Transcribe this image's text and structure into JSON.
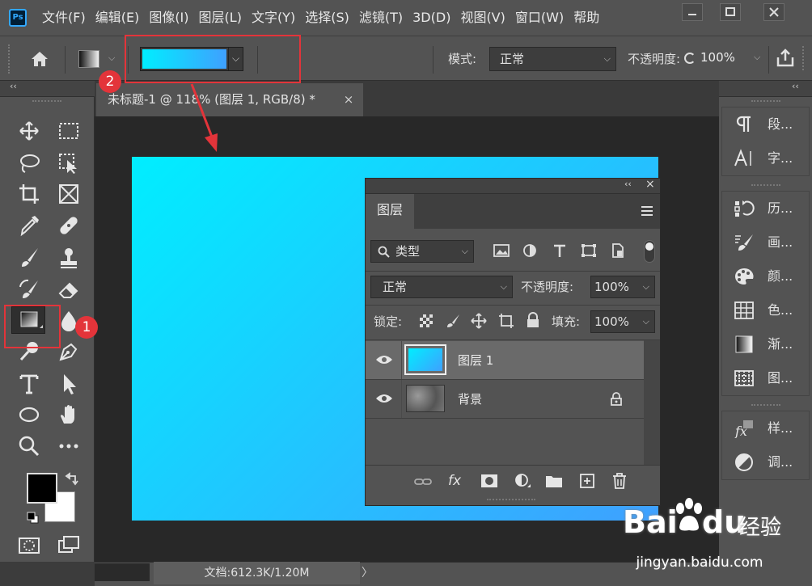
{
  "app": {
    "logo_text": "Ps",
    "menu": [
      "文件(F)",
      "编辑(E)",
      "图像(I)",
      "图层(L)",
      "文字(Y)",
      "选择(S)",
      "滤镜(T)",
      "3D(D)",
      "视图(V)",
      "窗口(W)",
      "帮助"
    ]
  },
  "options_bar": {
    "gradient_start": "#00eeff",
    "gradient_end": "#3fa0ff",
    "mode_label": "模式:",
    "mode_value": "正常",
    "opacity_label": "不透明度:",
    "opacity_value": "100%"
  },
  "document": {
    "tab_title": "未标题-1 @ 118% (图层 1, RGB/8) *",
    "close_glyph": "×",
    "status": "文档:612.3K/1.20M",
    "status_arrow": "〉"
  },
  "annotations": {
    "badge1": "1",
    "badge2": "2",
    "color": "#e3343a"
  },
  "layers_panel": {
    "tab_label": "图层",
    "filter_label": "类型",
    "blend_mode": "正常",
    "opacity_label": "不透明度:",
    "opacity_value": "100%",
    "lock_label": "锁定:",
    "fill_label": "填充:",
    "fill_value": "100%",
    "collapse_glyph": "‹‹",
    "close_glyph": "×",
    "layers": [
      {
        "name": "图层 1",
        "selected": true
      },
      {
        "name": "背景",
        "locked": true
      }
    ]
  },
  "right_panels": [
    {
      "label": "段...",
      "icon": "paragraph-icon"
    },
    {
      "label": "字...",
      "icon": "character-icon"
    },
    {
      "label": "历...",
      "icon": "history-icon"
    },
    {
      "label": "画...",
      "icon": "brushes-icon"
    },
    {
      "label": "颜...",
      "icon": "color-icon"
    },
    {
      "label": "色...",
      "icon": "swatches-icon"
    },
    {
      "label": "渐...",
      "icon": "gradients-icon"
    },
    {
      "label": "图...",
      "icon": "patterns-icon"
    },
    {
      "label": "样...",
      "icon": "styles-icon"
    },
    {
      "label": "调...",
      "icon": "adjustments-icon"
    }
  ],
  "toolbar": {
    "collapse_glyph": "‹‹"
  },
  "watermark": {
    "brand_text": "Bai",
    "brand_text2": "du",
    "brand_cn": "经验",
    "url": "jingyan.baidu.com"
  }
}
